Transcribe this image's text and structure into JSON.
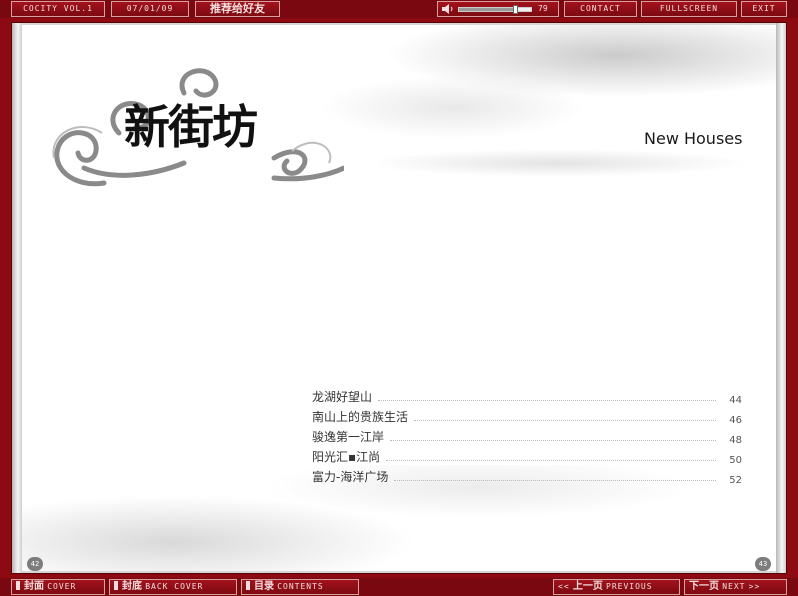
{
  "topbar": {
    "issue": "COCITY VOL.1",
    "date": "07/01/09",
    "recommend": "推荐给好友",
    "volume": "79",
    "volume_level": 0.79,
    "contact": "CONTACT",
    "fullscreen": "FULLSCREEN",
    "exit": "EXIT"
  },
  "page": {
    "logo": "新街坊",
    "section_title": "New Houses",
    "toc": [
      {
        "title": "龙湖好望山",
        "page": "44"
      },
      {
        "title": "南山上的贵族生活",
        "page": "46"
      },
      {
        "title": "骏逸第一江岸",
        "page": "48"
      },
      {
        "title": "阳光汇▪江尚",
        "page": "50"
      },
      {
        "title": "富力-海洋广场",
        "page": "52"
      }
    ],
    "left_page_number": "42",
    "right_page_number": "43"
  },
  "bottombar": {
    "cover_cn": "封面",
    "cover_en": "COVER",
    "back_cn": "封底",
    "back_en": "BACK COVER",
    "contents_cn": "目录",
    "contents_en": "CONTENTS",
    "prev_cn": "上一页",
    "prev_en": "PREVIOUS",
    "prev_arrow": "<<",
    "next_cn": "下一页",
    "next_en": "NEXT",
    "next_arrow": ">>"
  },
  "colors": {
    "frame_red": "#8e0a12",
    "button_border": "#d9a0a0"
  }
}
